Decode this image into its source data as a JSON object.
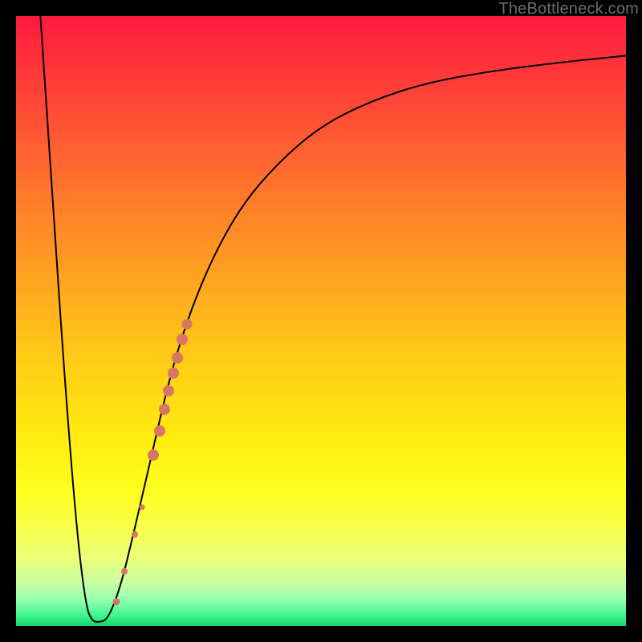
{
  "watermark": "TheBottleneck.com",
  "colors": {
    "frame_bg": "#000000",
    "curve": "#000000",
    "dot": "#d97563",
    "gradient_stops": [
      {
        "pos": 0.0,
        "hex": "#ff1a3d"
      },
      {
        "pos": 0.1,
        "hex": "#ff3a3a"
      },
      {
        "pos": 0.25,
        "hex": "#ff6a2f"
      },
      {
        "pos": 0.4,
        "hex": "#ff9a22"
      },
      {
        "pos": 0.55,
        "hex": "#ffc816"
      },
      {
        "pos": 0.7,
        "hex": "#ffee10"
      },
      {
        "pos": 0.78,
        "hex": "#ffff22"
      },
      {
        "pos": 0.84,
        "hex": "#f7ff4a"
      },
      {
        "pos": 0.89,
        "hex": "#ebff7a"
      },
      {
        "pos": 0.93,
        "hex": "#c8ffa0"
      },
      {
        "pos": 0.96,
        "hex": "#8effb0"
      },
      {
        "pos": 0.985,
        "hex": "#3cf58e"
      },
      {
        "pos": 1.0,
        "hex": "#18d66a"
      }
    ]
  },
  "chart_data": {
    "type": "line",
    "title": "",
    "xlabel": "",
    "ylabel": "",
    "xlim": [
      0,
      100
    ],
    "ylim": [
      0,
      100
    ],
    "grid": false,
    "legend": false,
    "curve": [
      {
        "x": 4,
        "y": 100
      },
      {
        "x": 6,
        "y": 70
      },
      {
        "x": 8,
        "y": 40
      },
      {
        "x": 10,
        "y": 15
      },
      {
        "x": 11.5,
        "y": 3
      },
      {
        "x": 12.5,
        "y": 0.8
      },
      {
        "x": 13.5,
        "y": 0.6
      },
      {
        "x": 15,
        "y": 1.0
      },
      {
        "x": 17,
        "y": 6
      },
      {
        "x": 19,
        "y": 14
      },
      {
        "x": 22,
        "y": 27
      },
      {
        "x": 25,
        "y": 40
      },
      {
        "x": 28,
        "y": 50
      },
      {
        "x": 32,
        "y": 60
      },
      {
        "x": 37,
        "y": 69
      },
      {
        "x": 43,
        "y": 76
      },
      {
        "x": 50,
        "y": 82
      },
      {
        "x": 58,
        "y": 86
      },
      {
        "x": 67,
        "y": 89
      },
      {
        "x": 78,
        "y": 91
      },
      {
        "x": 90,
        "y": 92.5
      },
      {
        "x": 100,
        "y": 93.5
      }
    ],
    "dots": [
      {
        "x": 16.5,
        "y": 4.0,
        "r": 4.5
      },
      {
        "x": 17.8,
        "y": 9.0,
        "r": 4.0
      },
      {
        "x": 19.5,
        "y": 15.0,
        "r": 4.0
      },
      {
        "x": 20.6,
        "y": 19.5,
        "r": 3.5
      },
      {
        "x": 22.5,
        "y": 28.0,
        "r": 7.0
      },
      {
        "x": 23.5,
        "y": 32.0,
        "r": 7.0
      },
      {
        "x": 24.3,
        "y": 35.5,
        "r": 7.0
      },
      {
        "x": 25.0,
        "y": 38.5,
        "r": 7.0
      },
      {
        "x": 25.8,
        "y": 41.5,
        "r": 7.0
      },
      {
        "x": 26.5,
        "y": 44.0,
        "r": 7.0
      },
      {
        "x": 27.3,
        "y": 47.0,
        "r": 7.0
      },
      {
        "x": 28.0,
        "y": 49.5,
        "r": 6.5
      }
    ]
  }
}
